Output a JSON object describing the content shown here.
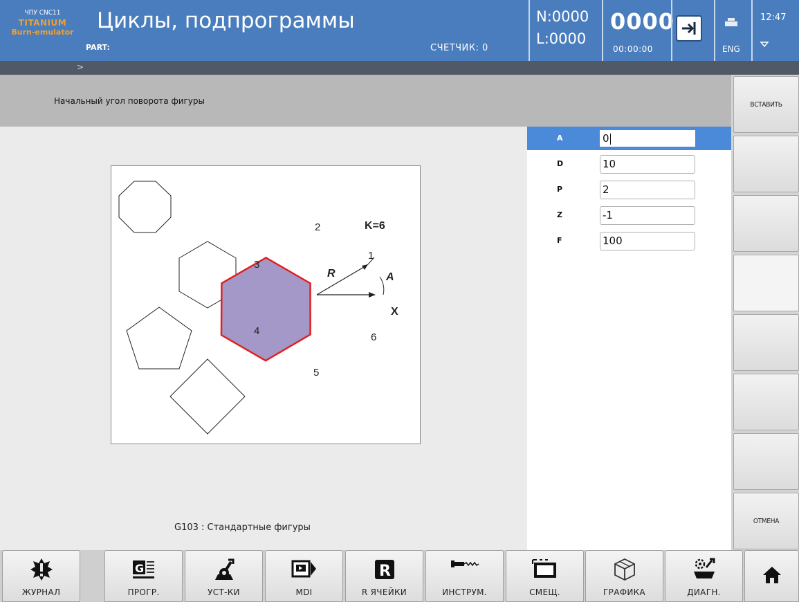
{
  "header": {
    "logo_line1": "ЧПУ CNC11",
    "logo_line2": "TITANIUM",
    "logo_line3": "Burn-emulator",
    "title": "Циклы, подпрограммы",
    "part_label": "PART:",
    "counter": "СЧЕТЧИК:  0",
    "n_value": "N:0000",
    "l_value": "L:0000",
    "program_number": "0000",
    "elapsed_time": "00:00:00",
    "language": "ENG",
    "clock": "12:47"
  },
  "breadcrumb": ">",
  "hint": "Начальный угол поворота фигуры",
  "diagram": {
    "k_label": "K=6",
    "r_label": "R",
    "a_label": "A",
    "x_label": "X",
    "vertex_labels": [
      "1",
      "2",
      "3",
      "4",
      "5",
      "6"
    ],
    "hexagon_fill": "#a498c8",
    "hexagon_stroke": "#e02020"
  },
  "cycle_label": "G103 : Стандартные фигуры",
  "params": [
    {
      "name": "A",
      "value": "0"
    },
    {
      "name": "D",
      "value": "10"
    },
    {
      "name": "P",
      "value": "2"
    },
    {
      "name": "Z",
      "value": "-1"
    },
    {
      "name": "F",
      "value": "100"
    }
  ],
  "softkeys": {
    "insert": "ВСТАВИТЬ",
    "cancel": "ОТМЕНА"
  },
  "bottom": [
    {
      "label": "ЖУРНАЛ",
      "icon": "journal-icon"
    },
    {
      "label": "ПРОГР.",
      "icon": "program-icon"
    },
    {
      "label": "УСТ-КИ",
      "icon": "settings-icon"
    },
    {
      "label": "MDI",
      "icon": "mdi-icon"
    },
    {
      "label": "R ЯЧЕЙКИ",
      "icon": "r-cells-icon"
    },
    {
      "label": "ИНСТРУМ.",
      "icon": "tool-icon"
    },
    {
      "label": "СМЕЩ.",
      "icon": "offset-icon"
    },
    {
      "label": "ГРАФИКА",
      "icon": "graphics-icon"
    },
    {
      "label": "ДИАГН.",
      "icon": "diagnostics-icon"
    },
    {
      "label": "",
      "icon": "home-icon"
    }
  ],
  "colors": {
    "header": "#4a7dbd",
    "accent_orange": "#f0a030",
    "selected_row": "#4a8ad8"
  }
}
